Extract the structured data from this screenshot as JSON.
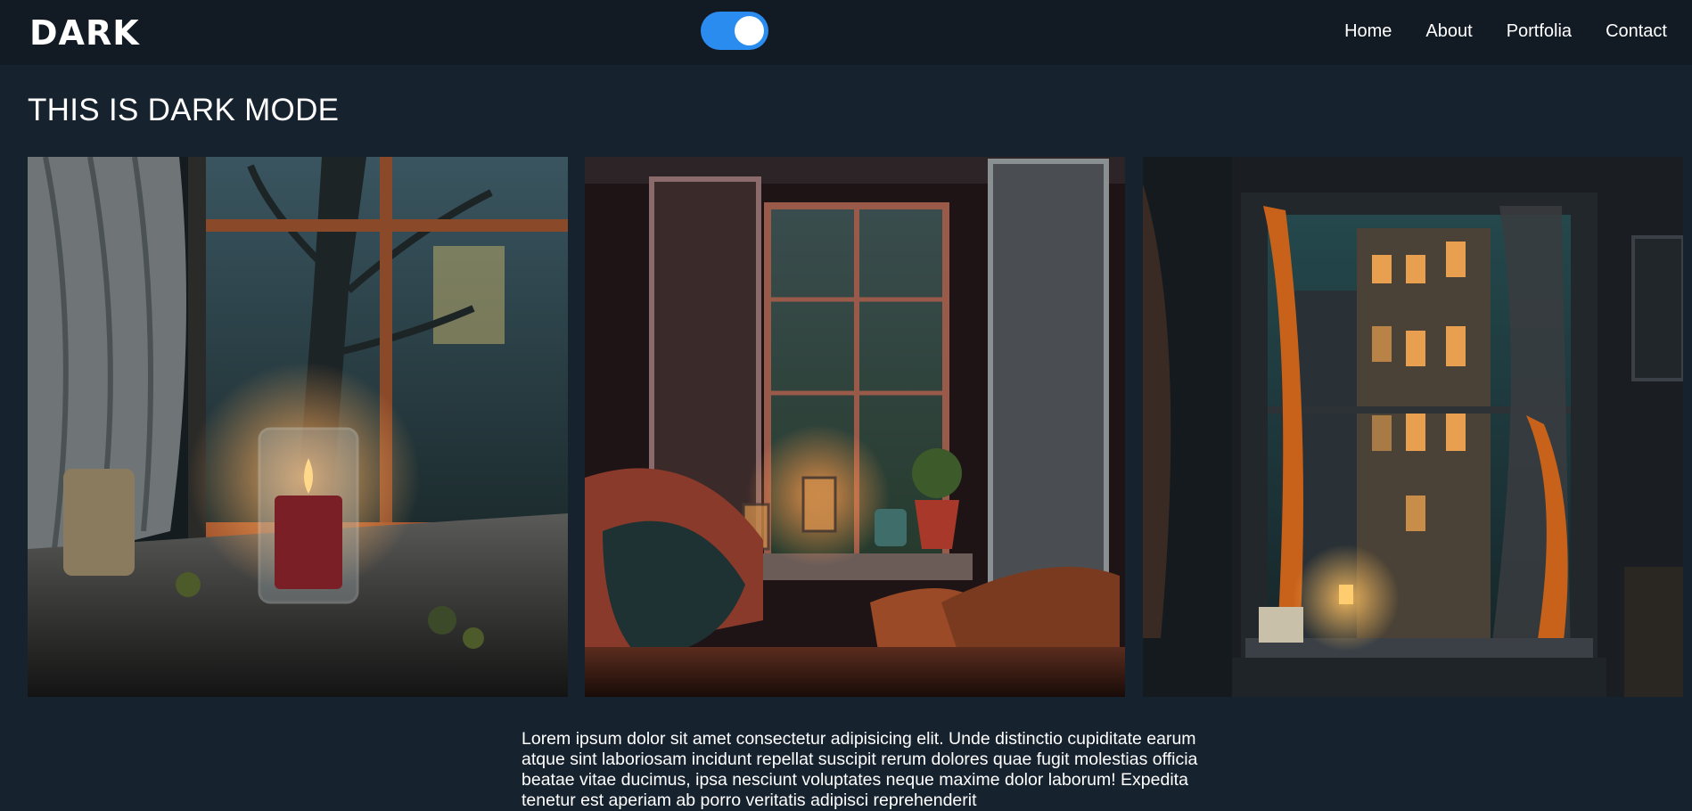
{
  "brand": {
    "logo_text": "DARK"
  },
  "theme_toggle": {
    "state": "on",
    "accent": "#2b8cf0"
  },
  "nav": {
    "items": [
      {
        "label": "Home"
      },
      {
        "label": "About"
      },
      {
        "label": "Portfolia"
      },
      {
        "label": "Contact"
      }
    ]
  },
  "page": {
    "title": "THIS IS DARK MODE"
  },
  "gallery": {
    "images": [
      {
        "subject": "candle on rainy windowsill"
      },
      {
        "subject": "cozy reading nook by rainy window"
      },
      {
        "subject": "open window overlooking night city apartments"
      }
    ]
  },
  "content": {
    "paragraph": "Lorem ipsum dolor sit amet consectetur adipisicing elit. Unde distinctio cupiditate earum atque sint laboriosam incidunt repellat suscipit rerum dolores quae fugit molestias officia beatae vitae ducimus, ipsa nesciunt voluptates neque maxime dolor laborum! Expedita tenetur est aperiam ab porro veritatis adipisci reprehenderit"
  },
  "colors": {
    "background": "#17222f",
    "navbar": "#121a24",
    "text": "#ffffff"
  }
}
